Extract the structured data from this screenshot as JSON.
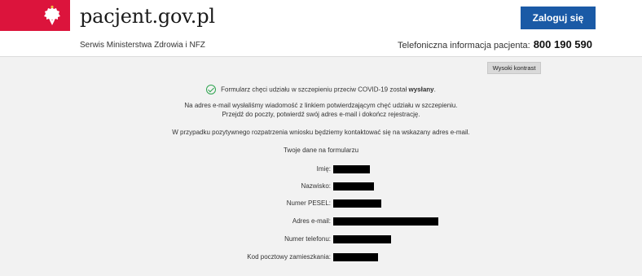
{
  "header": {
    "site_name": "pacjent.gov.pl",
    "login_label": "Zaloguj się",
    "ministry": "Serwis Ministerstwa Zdrowia i NFZ",
    "phone_label": "Telefoniczna informacja pacjenta:",
    "phone_number": "800 190 590"
  },
  "contrast_label": "Wysoki kontrast",
  "confirmation": {
    "text_prefix": "Formularz chęci udziału w szczepieniu przeciw COVID-19 został",
    "text_bold": "wysłany",
    "text_suffix": ".",
    "email_info_1": "Na adres e-mail wysłaliśmy wiadomość z linkiem potwierdzającym chęć udziału w szczepieniu.",
    "email_info_2": "Przejdź do poczty, potwierdź swój adres e-mail i dokończ rejestrację.",
    "contact_info": "W przypadku pozytywnego rozpatrzenia wniosku będziemy kontaktować się na wskazany adres e-mail.",
    "data_title": "Twoje dane na formularzu"
  },
  "fields": [
    {
      "label": "Imię:"
    },
    {
      "label": "Nazwisko:"
    },
    {
      "label": "Numer PESEL:"
    },
    {
      "label": "Adres e-mail:"
    },
    {
      "label": "Numer telefonu:"
    },
    {
      "label": "Kod pocztowy zamieszkania:"
    }
  ],
  "colors": {
    "brand_red": "#dc143c",
    "button_blue": "#1a5aa6",
    "success_green": "#2ea44f"
  }
}
